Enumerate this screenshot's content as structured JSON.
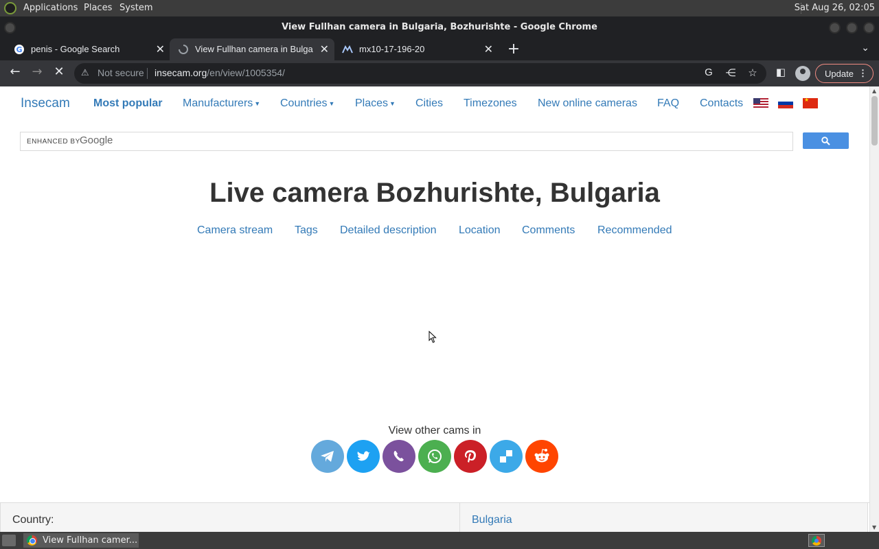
{
  "system_panel": {
    "menus": [
      "Applications",
      "Places",
      "System"
    ],
    "clock": "Sat Aug 26, 02:05"
  },
  "window": {
    "title": "View Fullhan camera in Bulgaria, Bozhurishte - Google Chrome"
  },
  "tabs": [
    {
      "label": "penis - Google Search",
      "icon": "google-g-icon",
      "active": false
    },
    {
      "label": "View Fullhan camera in Bulgaria",
      "icon": "loading-spinner-icon",
      "active": true
    },
    {
      "label": "mx10-17-196-20",
      "icon": "mikrotik-icon",
      "active": false
    }
  ],
  "toolbar": {
    "security_label": "Not secure",
    "url_host": "insecam.org",
    "url_path": "/en/view/1005354/",
    "update_label": "Update"
  },
  "site": {
    "brand": "Insecam",
    "nav": {
      "most_popular": "Most popular",
      "manufacturers": "Manufacturers",
      "countries": "Countries",
      "places": "Places",
      "cities": "Cities",
      "timezones": "Timezones",
      "new_online": "New online cameras",
      "faq": "FAQ",
      "contacts": "Contacts"
    },
    "search": {
      "enhanced_by": "ENHANCED BY",
      "google": "Google"
    },
    "page_title": "Live camera Bozhurishte, Bulgaria",
    "subnav": [
      "Camera stream",
      "Tags",
      "Detailed description",
      "Location",
      "Comments",
      "Recommended"
    ],
    "view_other": "View other cams in",
    "share_buttons": [
      {
        "name": "telegram",
        "color": "#64a9dc"
      },
      {
        "name": "twitter",
        "color": "#1da1f2"
      },
      {
        "name": "viber",
        "color": "#7b519d"
      },
      {
        "name": "whatsapp",
        "color": "#4caf50"
      },
      {
        "name": "pinterest",
        "color": "#cb2027"
      },
      {
        "name": "delicious",
        "color": "#3ca9e8"
      },
      {
        "name": "reddit",
        "color": "#ff4500"
      }
    ],
    "info": {
      "country_label": "Country:",
      "country_value": "Bulgaria"
    }
  },
  "taskbar": {
    "task_label": "View Fullhan camer..."
  }
}
